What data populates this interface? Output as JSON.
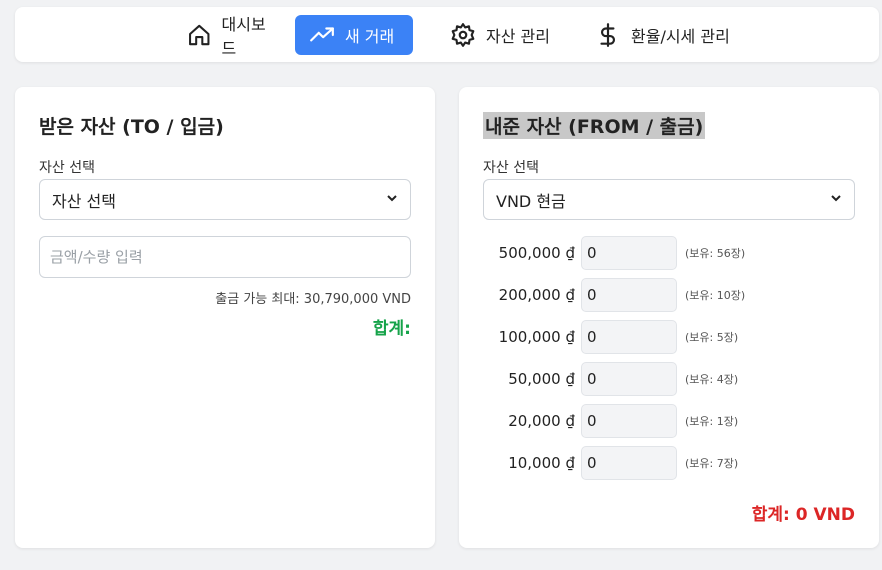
{
  "nav": {
    "dashboard": "대시보드",
    "new_trade": "새 거래",
    "assets": "자산 관리",
    "rates": "환율/시세 관리"
  },
  "left": {
    "title": "받은 자산 (TO / 입금)",
    "select_label": "자산 선택",
    "select_value": "자산 선택",
    "amount_placeholder": "금액/수량 입력",
    "max_note": "출금 가능 최대: 30,790,000 VND",
    "total": "합계:"
  },
  "right": {
    "title": "내준 자산 (FROM / 출금)",
    "select_label": "자산 선택",
    "select_value": "VND 현금",
    "denominations": [
      {
        "label": "500,000 ₫",
        "value": "0",
        "have": "(보유: 56장)"
      },
      {
        "label": "200,000 ₫",
        "value": "0",
        "have": "(보유: 10장)"
      },
      {
        "label": "100,000 ₫",
        "value": "0",
        "have": "(보유: 5장)"
      },
      {
        "label": "50,000 ₫",
        "value": "0",
        "have": "(보유: 4장)"
      },
      {
        "label": "20,000 ₫",
        "value": "0",
        "have": "(보유: 1장)"
      },
      {
        "label": "10,000 ₫",
        "value": "0",
        "have": "(보유: 7장)"
      }
    ],
    "total": "합계: 0 VND"
  },
  "colors": {
    "accent": "#3b82f6",
    "total_to": "#16a34a",
    "total_from": "#dc2626"
  }
}
